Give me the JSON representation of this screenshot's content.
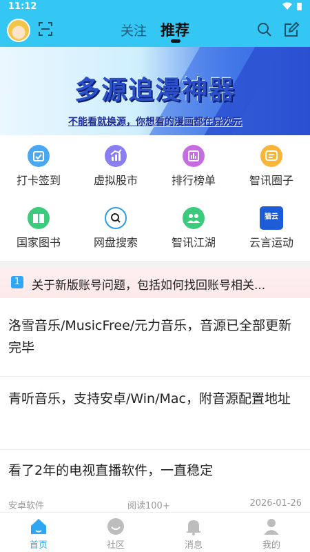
{
  "status_bar": {
    "time": "11:12"
  },
  "header": {
    "tabs": [
      {
        "label": "关注",
        "active": false
      },
      {
        "label": "推荐",
        "active": true
      }
    ],
    "colors": {
      "bar": "#34c7f4"
    }
  },
  "banner": {
    "title": "多源追漫神器",
    "subtitle": "不能看就换源，你想看的漫画都在异次元"
  },
  "grid": {
    "items": [
      {
        "label": "打卡签到",
        "icon": "calendar-check-icon",
        "color": "#4aa8f0"
      },
      {
        "label": "虚拟股市",
        "icon": "stock-chart-icon",
        "color": "#8a7ef2"
      },
      {
        "label": "排行榜单",
        "icon": "ranking-bars-icon",
        "color": "#c56ce0"
      },
      {
        "label": "智讯圈子",
        "icon": "chat-list-icon",
        "color": "#f7b53a"
      },
      {
        "label": "国家图书",
        "icon": "book-icon",
        "color": "#3ccb7d"
      },
      {
        "label": "网盘搜索",
        "icon": "magnifier-icon",
        "color": "#ffffff"
      },
      {
        "label": "智讯江湖",
        "icon": "people-icon",
        "color": "#3ccb7d"
      },
      {
        "label": "云言运动",
        "icon": "cloud-logo-icon",
        "color": "#1e5bd6",
        "logo_text": "猫云"
      }
    ]
  },
  "notice": {
    "number": "1",
    "text": "关于新版账号问题，包括如何找回账号相关..."
  },
  "posts": [
    {
      "title": "洛雪音乐/MusicFree/元力音乐，音源已全部更新完毕"
    },
    {
      "title": "青听音乐，支持安卓/Win/Mac，附音源配置地址"
    },
    {
      "title": "看了2年的电视直播软件，一直稳定",
      "category": "安卓软件",
      "reads": "阅读100+",
      "date": "2026-01-26"
    }
  ],
  "bottom_nav": [
    {
      "label": "首页",
      "icon": "home-icon",
      "active": true
    },
    {
      "label": "社区",
      "icon": "community-icon",
      "active": false
    },
    {
      "label": "消息",
      "icon": "bell-icon",
      "active": false
    },
    {
      "label": "我的",
      "icon": "user-icon",
      "active": false
    }
  ]
}
